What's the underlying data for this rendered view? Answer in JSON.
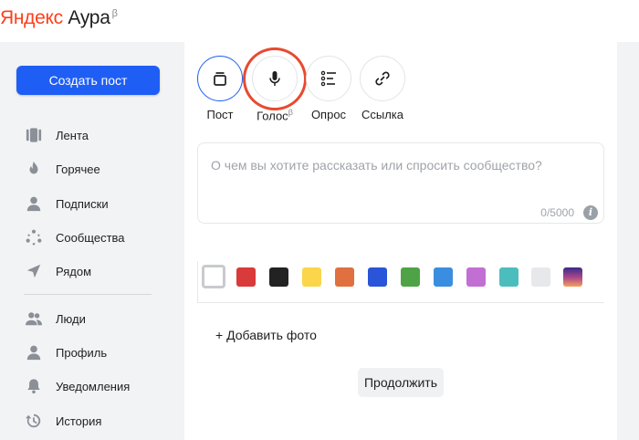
{
  "header": {
    "brand": "Яндекс",
    "product": "Аура",
    "beta": "β"
  },
  "sidebar": {
    "create_label": "Создать пост",
    "items": [
      {
        "label": "Лента",
        "icon": "feed-icon"
      },
      {
        "label": "Горячее",
        "icon": "fire-icon"
      },
      {
        "label": "Подписки",
        "icon": "person-icon"
      },
      {
        "label": "Сообщества",
        "icon": "communities-icon"
      },
      {
        "label": "Рядом",
        "icon": "location-arrow-icon"
      },
      {
        "label": "Люди",
        "icon": "people-icon"
      },
      {
        "label": "Профиль",
        "icon": "profile-icon"
      },
      {
        "label": "Уведомления",
        "icon": "bell-icon"
      },
      {
        "label": "История",
        "icon": "history-icon"
      }
    ]
  },
  "post_types": [
    {
      "label": "Пост",
      "icon": "post-icon",
      "active": true
    },
    {
      "label": "Голос",
      "beta": "β",
      "icon": "microphone-icon",
      "highlighted": true
    },
    {
      "label": "Опрос",
      "icon": "poll-list-icon"
    },
    {
      "label": "Ссылка",
      "icon": "link-icon"
    }
  ],
  "editor": {
    "placeholder": "О чем вы хотите рассказать или спросить сообщество?",
    "counter": "0/5000",
    "info": "i"
  },
  "background_colors": [
    "#ffffff",
    "#d93a3a",
    "#222222",
    "#fbd54a",
    "#e07040",
    "#2a55d8",
    "#4ea346",
    "#3a8ee0",
    "#c26fd4",
    "#4cbdbd",
    "#e6e8ec",
    "gradient-sunset"
  ],
  "add_photo_label": "+ Добавить фото",
  "continue_label": "Продолжить",
  "colors": {
    "accent": "#1f5ef5",
    "brand_red": "#fc3f1d",
    "highlight_ring": "#e84a2f"
  }
}
